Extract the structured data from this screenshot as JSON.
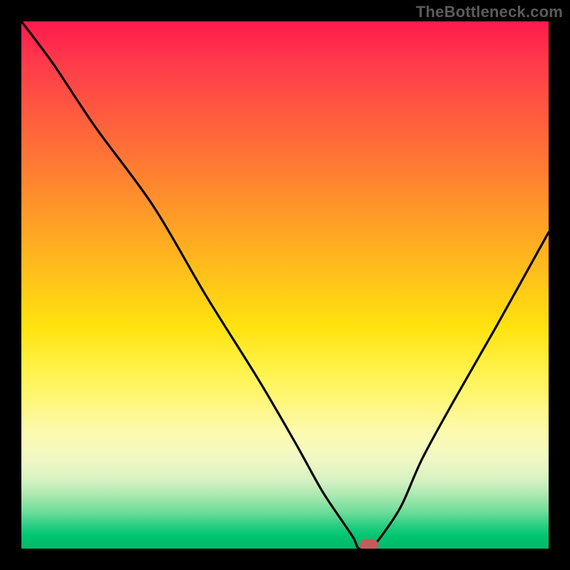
{
  "watermark": "TheBottleneck.com",
  "colors": {
    "frame": "#000000",
    "watermark_text": "#5b5b5b",
    "curve": "#000000",
    "marker_fill": "#c75a5c",
    "gradient_top": "#ff1a4d",
    "gradient_bottom": "#00b865"
  },
  "chart_data": {
    "type": "line",
    "title": "",
    "xlabel": "",
    "ylabel": "",
    "xlim": [
      0,
      100
    ],
    "ylim": [
      0,
      100
    ],
    "grid": false,
    "legend": false,
    "series": [
      {
        "name": "bottleneck-curve",
        "x": [
          0,
          6,
          14,
          25,
          35,
          45,
          52,
          57,
          61,
          63,
          64,
          66,
          68,
          72,
          76,
          82,
          90,
          100
        ],
        "values": [
          100,
          92,
          80,
          65,
          48,
          32,
          20,
          11,
          5,
          2,
          0,
          0,
          2,
          8,
          17,
          28,
          42,
          60
        ]
      }
    ],
    "marker": {
      "x": 66,
      "y": 0.7
    }
  }
}
